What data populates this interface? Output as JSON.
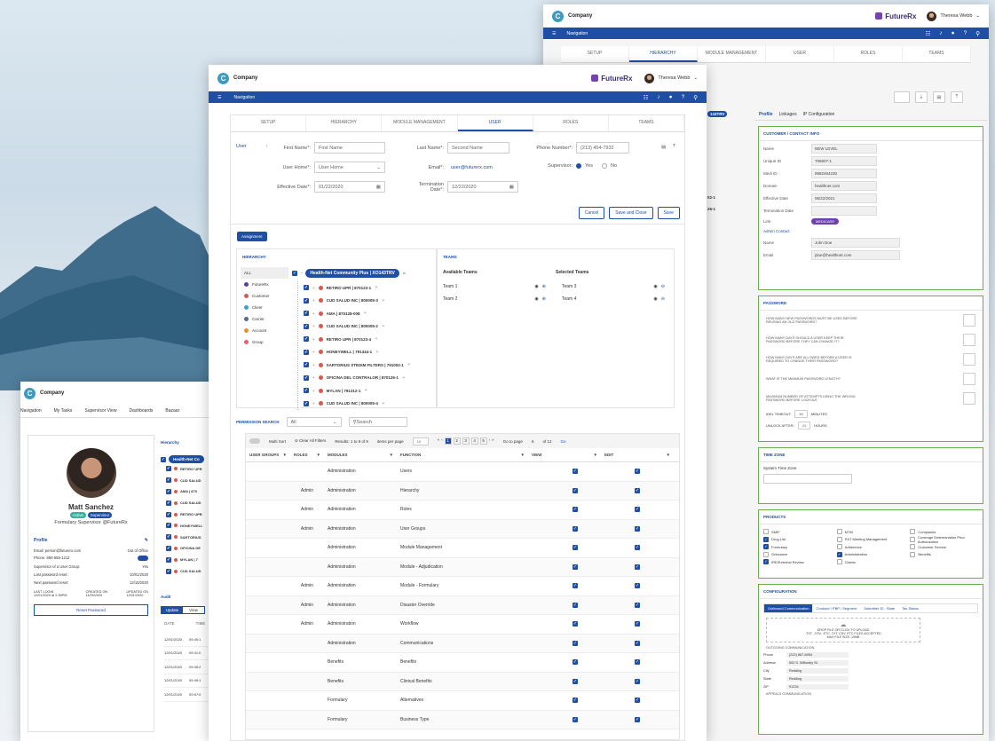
{
  "back_window": {
    "brand": "Company",
    "partner": "FutureRx",
    "user_name": "Theresa Webb",
    "nav_label": "Navigation",
    "tabs": [
      "SETUP",
      "HIERARCHY",
      "MODULE MANAGEMENT",
      "USER",
      "ROLES",
      "TEAMS"
    ],
    "sub_tabs": [
      "Profile",
      "Linkages",
      "IP Configuration"
    ],
    "customer_section": {
      "title": "CUSTOMER / CONTACT INFO",
      "fields": [
        {
          "label": "Name",
          "value": "NEW LEVEL"
        },
        {
          "label": "Unique ID",
          "value": "706807-1"
        },
        {
          "label": "Medi ID",
          "value": "9982464230"
        },
        {
          "label": "Domain",
          "value": "healthnet.com"
        },
        {
          "label": "Effective Date",
          "value": "06/22/2021"
        },
        {
          "label": "Termination Date",
          "value": ""
        }
      ],
      "link_label": "Link",
      "link_value": "MEDICARE",
      "admin_contact": "Admin Contact",
      "contact_fields": [
        {
          "label": "Name",
          "value": "John Doe"
        },
        {
          "label": "Email",
          "value": "jdoe@healthnet.com"
        }
      ],
      "id_suffix": "143TRV"
    },
    "password_section": {
      "title": "PASSWORD",
      "questions": [
        "HOW MANY NEW PASSWORDS MUST BE USED BEFORE REUSING AN OLD PASSWORD?",
        "HOW MANY DAYS SHOULD A USER KEEP THEIR PASSWORD BEFORE THEY CAN CHANGE IT?",
        "HOW MANY DAYS ARE ALLOWED BEFORE A USER IS REQUIRED TO CHANGE THEIR PASSWORD?",
        "WHAT IS THE MINIMUM PASSWORD LENGTH?",
        "MAXIMUM NUMBER OF ATTEMPTS USING THE WRONG PASSWORD BEFORE LOCKOUT"
      ],
      "idle_label": "IDEL TIMEOUT:",
      "idle_value": "60",
      "idle_unit": "MINUTES",
      "unlock_label": "UNLOCK AFTER:",
      "unlock_value": "24",
      "unlock_unit": "HOURS"
    },
    "timezone_section": {
      "title": "TIME ZONE",
      "label": "System Time Zone"
    },
    "products_section": {
      "title": "PRODUCTS",
      "col1": [
        {
          "label": "SMIF",
          "checked": false
        },
        {
          "label": "Drug List",
          "checked": true
        },
        {
          "label": "Formulary",
          "checked": true
        },
        {
          "label": "Grievance",
          "checked": false
        },
        {
          "label": "IRE/External Review",
          "checked": true
        }
      ],
      "col2": [
        {
          "label": "MTM",
          "checked": false
        },
        {
          "label": "P&T Meeting Management",
          "checked": false
        },
        {
          "label": "Adherence",
          "checked": false
        },
        {
          "label": "Administration",
          "checked": true
        },
        {
          "label": "Claims",
          "checked": false
        }
      ],
      "col3": [
        {
          "label": "Complaints",
          "checked": false
        },
        {
          "label": "Coverage Determination Prior Authorization",
          "checked": false
        },
        {
          "label": "Customer Service",
          "checked": false
        },
        {
          "label": "Benefits",
          "checked": false
        }
      ]
    },
    "config_section": {
      "title": "CONFIGURATION",
      "tabs": [
        "Outbound Communication",
        "Contract / PBP / Segment",
        "Submitter ID : State",
        "Tax Status"
      ],
      "drop_text": "DROP FILE OR CLICK TO UPLOAD",
      "drop_sub": ".TXT, .CSV, .ETC. TXT, CSV, ETC FILES ACCEPTED",
      "drop_max": "MAX FILE SIZE: 10MB",
      "outgoing_title": "OUTGOING COMMUNICATION",
      "fields": [
        {
          "label": "Phone",
          "value": "(222) 867-6954"
        },
        {
          "label": "Address",
          "value": "500 S. Willowby St."
        },
        {
          "label": "City",
          "value": "Redding"
        },
        {
          "label": "State",
          "value": "Redding"
        },
        {
          "label": "ZIP",
          "value": "91234"
        }
      ],
      "appeals_title": "APPEALS COMMUNICATION"
    },
    "tree_codes": [
      "02-1",
      "26-1"
    ]
  },
  "front_window": {
    "brand": "Company",
    "partner": "FutureRx",
    "user_name": "Theresa Webb",
    "nav_label": "Navigation",
    "tabs": [
      "SETUP",
      "HIERARCHY",
      "MODULE MANAGEMENT",
      "USER",
      "ROLES",
      "TEAMS"
    ],
    "breadcrumb": "User",
    "form": {
      "first_name_label": "First Name*:",
      "first_name_ph": "First Name",
      "last_name_label": "Last Name*:",
      "last_name_ph": "Second Name",
      "phone_label": "Phone Number*:",
      "phone_value": "(213) 454-7932",
      "user_home_label": "User Home*:",
      "user_home_value": "User Home",
      "email_label": "Email*:",
      "email_value": "user@futurerx.com",
      "supervisor_label": "Supervisor:",
      "yes": "Yes",
      "no": "No",
      "eff_label": "Effective Date*:",
      "eff_value": "01/22/2020",
      "term_label": "Termination Date*:",
      "term_value": "12/22/2020"
    },
    "buttons": {
      "cancel": "Cancel",
      "save_close": "Save and Close",
      "save": "Save"
    },
    "assignment": "Assignment",
    "hierarchy_title": "HIERARCHY",
    "teams_title": "TEAMS",
    "legend": [
      {
        "label": "ALL",
        "color": ""
      },
      {
        "label": "FutureRx",
        "color": "#5b3fa5"
      },
      {
        "label": "Customer",
        "color": "#e0564b"
      },
      {
        "label": "Client",
        "color": "#36a3c9"
      },
      {
        "label": "Carrier",
        "color": "#4f6e8a"
      },
      {
        "label": "Account",
        "color": "#e8902a"
      },
      {
        "label": "Group",
        "color": "#f05b6e"
      }
    ],
    "root_node": "Health-Net Community Plus | XO143TRV",
    "nodes": [
      "RETIRO UPR | 870123-1",
      "CUD SALUD INC | 800005-3",
      "AMA | 870128-008",
      "CUD SALUD INC | 800005-2",
      "RETIRO UPR | 870123-4",
      "HONEYWELL | 791344-1",
      "SARTORIUS STEDIM FILTERS | 791002-1",
      "OFICINA DEL CONTRALOR | 870126-1",
      "MYLAN | 791312-1",
      "CUD SALUD INC | 800005-4"
    ],
    "available_teams_title": "Available Teams",
    "selected_teams_title": "Selected Teams",
    "available_teams": [
      "Team 1",
      "Team 2"
    ],
    "selected_teams": [
      "Team 3",
      "Team 4"
    ],
    "perm_search_label": "PERMISSION SEARCH",
    "perm_filter": "All",
    "perm_search_ph": "Search",
    "multisort": "Multi Sort",
    "clear_filters": "Clear All Filters",
    "results": "Results: 1 to 9 of 9",
    "items_per_page": "items per page",
    "ipp_value": "10",
    "pages": [
      "1",
      "2",
      "3",
      "4",
      "5"
    ],
    "go_to_page": "Go to page",
    "go_page_value": "6",
    "of_pages": "of 12",
    "go": "Go",
    "columns": [
      "USER GROUPS",
      "ROLES",
      "MODULES",
      "FUNCTION",
      "VIEW",
      "EDIT"
    ],
    "rows": [
      {
        "role": "",
        "module": "Administration",
        "function": "Users"
      },
      {
        "role": "Admin",
        "module": "Administration",
        "function": "Hierarchy"
      },
      {
        "role": "Admin",
        "module": "Administration",
        "function": "Roles"
      },
      {
        "role": "Admin",
        "module": "Administration",
        "function": "User Groups"
      },
      {
        "role": "",
        "module": "Administration",
        "function": "Module Management"
      },
      {
        "role": "",
        "module": "Administration",
        "function": "Module - Adjudication"
      },
      {
        "role": "Admin",
        "module": "Administration",
        "function": "Module - Formulary"
      },
      {
        "role": "Admin",
        "module": "Administration",
        "function": "Disaster Override"
      },
      {
        "role": "Admin",
        "module": "Administration",
        "function": "Workflow"
      },
      {
        "role": "",
        "module": "Administration",
        "function": "Communications"
      },
      {
        "role": "",
        "module": "Benefits",
        "function": "Benefits"
      },
      {
        "role": "",
        "module": "Benefits",
        "function": "Clinical Benefits"
      },
      {
        "role": "",
        "module": "Formulary",
        "function": "Alternatives"
      },
      {
        "role": "",
        "module": "Formulary",
        "function": "Business Type"
      }
    ]
  },
  "profile_window": {
    "brand": "Company",
    "nav_items": [
      "Navigation",
      "My Tasks",
      "Supervisor View",
      "Dashboards",
      "Bazaar"
    ],
    "name": "Matt Sanchez",
    "badge_active": "Active",
    "badge_supervisor": "Supervisor",
    "role": "Formulary Supervisor @FutureRx",
    "profile_label": "Profile",
    "email": "Email: person@futurerx.com",
    "out_of_office": "Out of Office",
    "phone": "Phone: 880-555-1212",
    "supervisor_group": "Supervisor of a User Group:",
    "supervisor_group_value": "Yes",
    "last_pw_reset": "Last password reset:",
    "last_pw_reset_value": "10/01/2020",
    "next_pw_reset": "Next password reset:",
    "next_pw_reset_value": "12/10/2020",
    "last_login_label": "LAST LOGIN",
    "last_login_value": "12/01/2020 at 2:39PM",
    "created_label": "CREATED ON",
    "created_value": "11/09/2020",
    "updated_label": "UPDATED ON",
    "updated_value": "12/01/2020",
    "reset_button": "Reset Password",
    "tab_hierarchy": "Hierarchy",
    "tree_root": "Health-Net Co",
    "tree_items": [
      "RETIRO UPR",
      "CUD SALUD",
      "AMA | 870",
      "CUD SALUD",
      "RETIRO UPR",
      "HONEYWELL",
      "SARTORIUS",
      "OFICINA DE",
      "MYLAN | 7",
      "CUD SALUD"
    ],
    "audit_label": "Audit",
    "audit_tabs": [
      "Update",
      "View"
    ],
    "audit_cols": [
      "DATE",
      "TIME"
    ],
    "audit_rows": [
      [
        "12/01/2020",
        "09:40:1"
      ],
      [
        "12/01/2020",
        "09:41:0"
      ],
      [
        "12/01/2020",
        "09:45:2"
      ],
      [
        "12/01/2020",
        "09:49:1"
      ],
      [
        "12/01/2020",
        "09:57:0"
      ]
    ]
  }
}
